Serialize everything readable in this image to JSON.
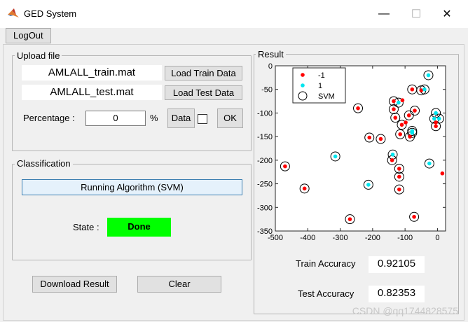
{
  "window": {
    "title": "GED System",
    "minimize": "—",
    "maximize": "☐",
    "close": "✕"
  },
  "menu": {
    "logout": "LogOut"
  },
  "upload": {
    "panel_title": "Upload file",
    "train_file": "AMLALL_train.mat",
    "test_file": "AMLALL_test.mat",
    "load_train": "Load Train Data",
    "load_test": "Load Test Data",
    "percentage_label": "Percentage :",
    "percentage_value": "0",
    "percent_sign": "%",
    "data_btn": "Data",
    "ok_btn": "OK"
  },
  "classification": {
    "panel_title": "Classification",
    "run_btn": "Running Algorithm (SVM)",
    "state_label": "State :",
    "state_value": "Done"
  },
  "actions": {
    "download": "Download Result",
    "clear": "Clear"
  },
  "result": {
    "panel_title": "Result",
    "train_label": "Train Accuracy",
    "train_value": "0.92105",
    "test_label": "Test Accuracy",
    "test_value": "0.82353"
  },
  "watermark": "CSDN @qq1744828575",
  "colors": {
    "class_neg": "#ff0000",
    "class_pos": "#00e5ee",
    "done_bg": "#00ff00"
  },
  "chart_data": {
    "type": "scatter",
    "xlim": [
      -500,
      25
    ],
    "ylim": [
      -350,
      0
    ],
    "xticks": [
      -500,
      -400,
      -300,
      -200,
      -100,
      0
    ],
    "yticks": [
      0,
      -50,
      -100,
      -150,
      -200,
      -250,
      -300,
      -350
    ],
    "legend": {
      "placement": "top-left",
      "entries": [
        "-1",
        "1",
        "SVM"
      ]
    },
    "series": [
      {
        "name": "-1",
        "color": "#ff0000",
        "points": [
          [
            -470,
            -213
          ],
          [
            -410,
            -260
          ],
          [
            -270,
            -325
          ],
          [
            -245,
            -90
          ],
          [
            -210,
            -152
          ],
          [
            -175,
            -155
          ],
          [
            -140,
            -200
          ],
          [
            -135,
            -75
          ],
          [
            -135,
            -92
          ],
          [
            -130,
            -110
          ],
          [
            -115,
            -145
          ],
          [
            -118,
            -218
          ],
          [
            -118,
            -235
          ],
          [
            -118,
            -262
          ],
          [
            -110,
            -125
          ],
          [
            -108,
            -73
          ],
          [
            -98,
            -120
          ],
          [
            -88,
            -105
          ],
          [
            -85,
            -150
          ],
          [
            -78,
            -50
          ],
          [
            -72,
            -320
          ],
          [
            -70,
            -95
          ],
          [
            -50,
            -52
          ],
          [
            -5,
            -120
          ],
          [
            -5,
            -128
          ],
          [
            15,
            -228
          ]
        ]
      },
      {
        "name": "1",
        "color": "#00e5ee",
        "points": [
          [
            -315,
            -192
          ],
          [
            -213,
            -252
          ],
          [
            -138,
            -188
          ],
          [
            -120,
            -78
          ],
          [
            -78,
            -138
          ],
          [
            -78,
            -142
          ],
          [
            -40,
            -50
          ],
          [
            -28,
            -20
          ],
          [
            -25,
            -207
          ],
          [
            -10,
            -112
          ],
          [
            -5,
            -100
          ],
          [
            5,
            -112
          ]
        ]
      }
    ],
    "svm": [
      [
        -470,
        -213
      ],
      [
        -410,
        -260
      ],
      [
        -315,
        -192
      ],
      [
        -270,
        -325
      ],
      [
        -245,
        -90
      ],
      [
        -213,
        -252
      ],
      [
        -210,
        -152
      ],
      [
        -175,
        -155
      ],
      [
        -140,
        -200
      ],
      [
        -138,
        -188
      ],
      [
        -135,
        -75
      ],
      [
        -135,
        -92
      ],
      [
        -130,
        -110
      ],
      [
        -120,
        -78
      ],
      [
        -118,
        -218
      ],
      [
        -118,
        -235
      ],
      [
        -118,
        -262
      ],
      [
        -115,
        -145
      ],
      [
        -110,
        -125
      ],
      [
        -88,
        -105
      ],
      [
        -85,
        -150
      ],
      [
        -78,
        -50
      ],
      [
        -78,
        -138
      ],
      [
        -78,
        -142
      ],
      [
        -72,
        -320
      ],
      [
        -70,
        -95
      ],
      [
        -50,
        -52
      ],
      [
        -40,
        -50
      ],
      [
        -28,
        -20
      ],
      [
        -25,
        -207
      ],
      [
        -10,
        -112
      ],
      [
        -5,
        -100
      ],
      [
        -5,
        -128
      ],
      [
        5,
        -112
      ]
    ]
  }
}
